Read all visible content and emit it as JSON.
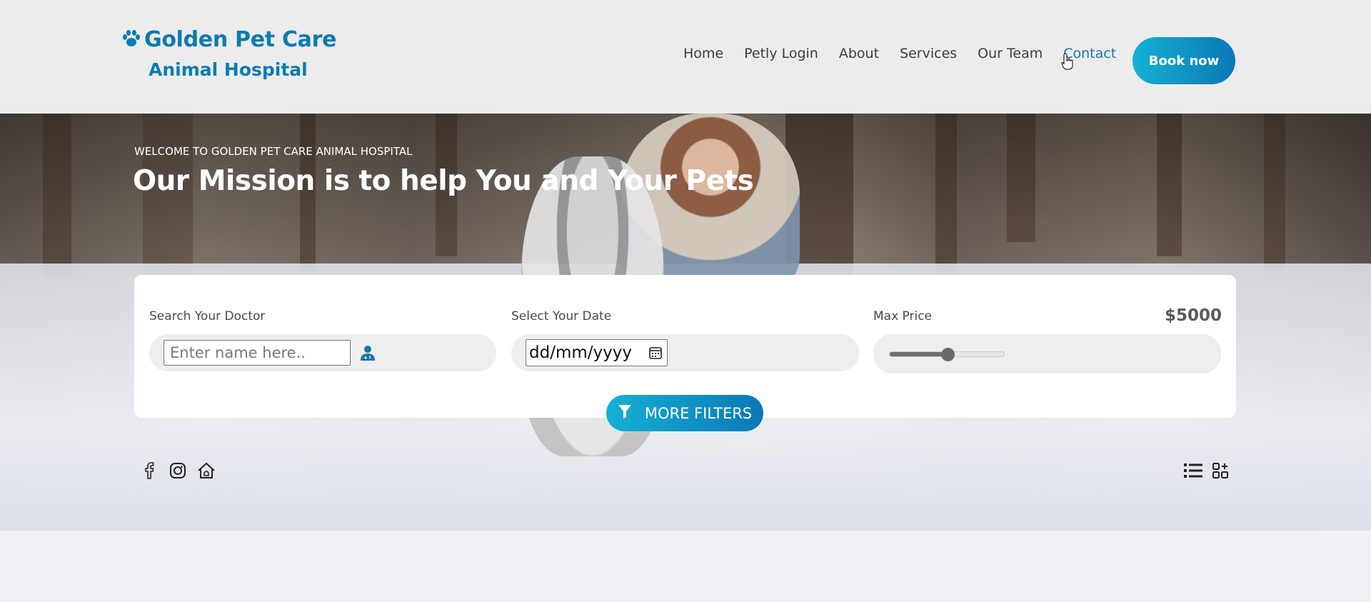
{
  "header": {
    "logo_title": "Golden Pet Care",
    "logo_subtitle": "Animal Hospital",
    "nav": [
      "Home",
      "Petly Login",
      "About",
      "Services",
      "Our Team",
      "Contact"
    ],
    "active_nav": "Contact",
    "book_label": "Book now"
  },
  "hero": {
    "welcome": "WELCOME TO GOLDEN PET CARE ANIMAL HOSPITAL",
    "headline": "Our Mission is to help You and Your Pets"
  },
  "search": {
    "doctor_label": "Search Your Doctor",
    "doctor_placeholder": "Enter name here..",
    "date_label": "Select Your Date",
    "date_placeholder": "dd/mm/yyyy",
    "price_label": "Max Price",
    "price_value": "$5000",
    "price_slider_fraction": 0.5,
    "more_filters_label": "MORE FILTERS"
  },
  "colors": {
    "brand": "#0c7bb3",
    "accent_gradient_start": "#14b1d3",
    "accent_gradient_end": "#0b78b7"
  },
  "icons": {
    "logo": "paw-icon",
    "doctor": "doctor-icon",
    "date": "calendar-icon",
    "filters": "filter-icon",
    "social": [
      "facebook-icon",
      "instagram-icon",
      "home-icon"
    ],
    "view": [
      "list-view-icon",
      "grid-view-icon"
    ]
  }
}
